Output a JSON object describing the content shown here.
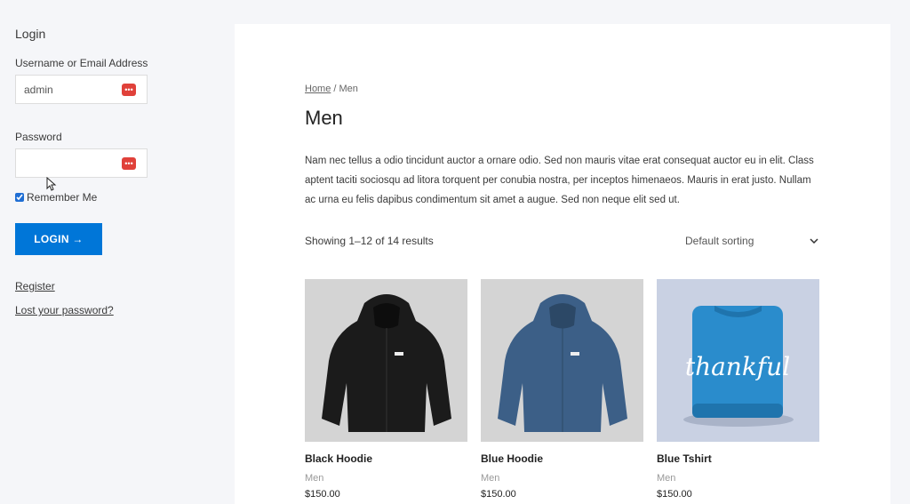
{
  "login_widget": {
    "title": "Login",
    "username_label": "Username or Email Address",
    "username_value": "admin",
    "password_label": "Password",
    "password_value": "",
    "remember_label": "Remember Me",
    "remember_checked": true,
    "login_button": "LOGIN →",
    "register_link": "Register",
    "lost_password_link": "Lost your password?"
  },
  "breadcrumb": {
    "home": "Home",
    "separator": " / ",
    "current": "Men"
  },
  "page_title": "Men",
  "description": "Nam nec tellus a odio tincidunt auctor a ornare odio. Sed non mauris vitae erat consequat auctor eu in elit. Class aptent taciti sociosqu ad litora torquent per conubia nostra, per inceptos himenaeos. Mauris in erat justo. Nullam ac urna eu felis dapibus condimentum sit amet a augue. Sed non neque elit sed ut.",
  "result_count": "Showing 1–12 of 14 results",
  "sorting": {
    "selected": "Default sorting"
  },
  "products": [
    {
      "name": "Black Hoodie",
      "category": "Men",
      "price": "$150.00",
      "color": "#1b1b1b"
    },
    {
      "name": "Blue Hoodie",
      "category": "Men",
      "price": "$150.00",
      "color": "#3c5f87"
    },
    {
      "name": "Blue Tshirt",
      "category": "Men",
      "price": "$150.00",
      "color": "#2a8ccc",
      "print_text": "thankful"
    }
  ],
  "colors": {
    "accent": "#0076d8",
    "password_manager_icon": "#e0413a"
  }
}
